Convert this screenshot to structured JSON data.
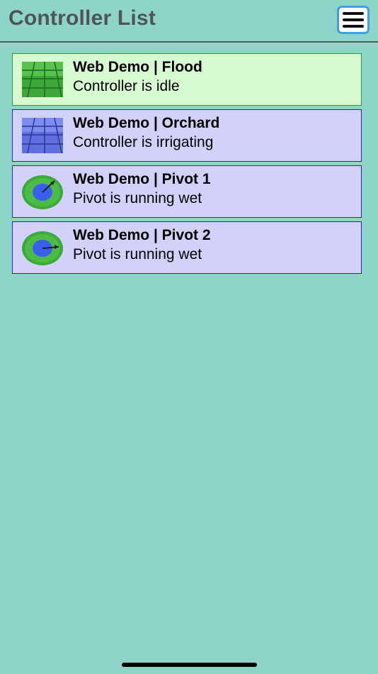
{
  "header": {
    "title": "Controller List",
    "menu_icon": "hamburger-menu-icon"
  },
  "controllers": [
    {
      "name": "Web Demo | Flood",
      "status": "Controller is idle",
      "icon": "flood-field-icon",
      "state": "idle"
    },
    {
      "name": "Web Demo | Orchard",
      "status": "Controller is irrigating",
      "icon": "orchard-field-icon",
      "state": "active"
    },
    {
      "name": "Web Demo | Pivot 1",
      "status": "Pivot is running wet",
      "icon": "pivot-icon",
      "state": "active"
    },
    {
      "name": "Web Demo | Pivot 2",
      "status": "Pivot is running wet",
      "icon": "pivot-icon",
      "state": "active"
    }
  ],
  "colors": {
    "background": "#8ed4c9",
    "idle_fill": "#d8fad2",
    "idle_border": "#2e9a2e",
    "active_fill": "#d2d1fa",
    "active_border": "#2525c0",
    "menu_border": "#3f9ee6"
  }
}
